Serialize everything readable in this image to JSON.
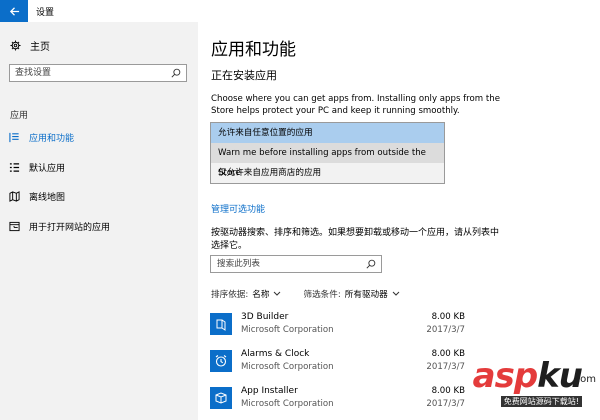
{
  "window": {
    "title": "设置"
  },
  "sidebar": {
    "home": "主页",
    "search_placeholder": "查找设置",
    "section": "应用",
    "items": [
      {
        "label": "应用和功能",
        "icon": "list-icon",
        "active": true
      },
      {
        "label": "默认应用",
        "icon": "default-apps-icon"
      },
      {
        "label": "离线地图",
        "icon": "map-icon"
      },
      {
        "label": "用于打开网站的应用",
        "icon": "web-apps-icon"
      }
    ]
  },
  "main": {
    "title": "应用和功能",
    "subtitle": "正在安装应用",
    "description": "Choose where you can get apps from. Installing only apps from the Store helps protect your PC and keep it running smoothly.",
    "install_options": [
      "允许来自任意位置的应用",
      "Warn me before installing apps from outside the Store",
      "仅允许来自应用商店的应用"
    ],
    "manage_link": "管理可选功能",
    "list_description": "按驱动器搜索、排序和筛选。如果想要卸载或移动一个应用，请从列表中选择它。",
    "list_search_placeholder": "搜索此列表",
    "sort": {
      "label": "排序依据:",
      "value": "名称"
    },
    "filter": {
      "label": "筛选条件:",
      "value": "所有驱动器"
    },
    "apps": [
      {
        "name": "3D Builder",
        "publisher": "Microsoft Corporation",
        "size": "8.00 KB",
        "date": "2017/3/7",
        "icon": "3d-builder-icon"
      },
      {
        "name": "Alarms & Clock",
        "publisher": "Microsoft Corporation",
        "size": "8.00 KB",
        "date": "2017/3/7",
        "icon": "alarm-clock-icon"
      },
      {
        "name": "App Installer",
        "publisher": "Microsoft Corporation",
        "size": "8.00 KB",
        "date": "2017/3/7",
        "icon": "package-icon"
      }
    ]
  },
  "watermark": {
    "main": "asp",
    "accent": "ku",
    "suffix": ".com",
    "sub": "免费网站源码下载站!"
  },
  "colors": {
    "accent": "#0b6ec9",
    "sidebar_bg": "#f2f2f2",
    "selected_option": "#aacdee"
  }
}
